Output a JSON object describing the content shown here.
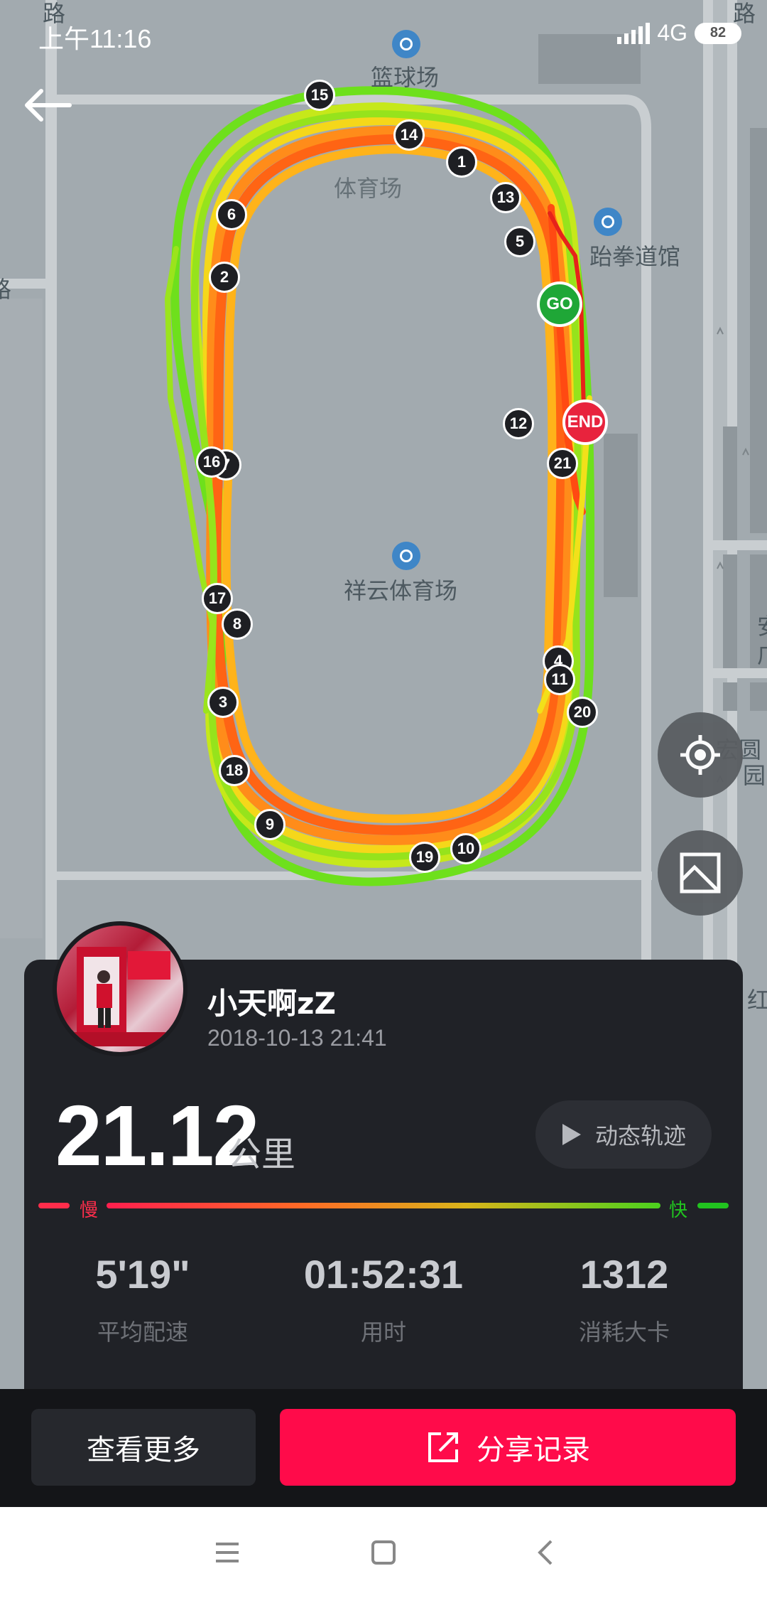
{
  "status_bar": {
    "time": "上午11:16",
    "network": "4G",
    "battery": "82"
  },
  "map": {
    "labels": {
      "road_top_left": "路",
      "road_top_right": "路",
      "basketball": "篮球场",
      "stadium_small": "体育场",
      "taekwondo": "跆拳道馆",
      "stadium": "祥云体育场",
      "right_an": "安",
      "right_guang": "广",
      "hongyuan": "宏圆",
      "yuan": "园",
      "hong": "红",
      "left_edge": "路"
    },
    "km_markers": [
      "1",
      "2",
      "3",
      "4",
      "5",
      "6",
      "7",
      "8",
      "9",
      "10",
      "11",
      "12",
      "13",
      "14",
      "15",
      "16",
      "17",
      "18",
      "19",
      "20",
      "21"
    ],
    "start_label": "GO",
    "end_label": "END"
  },
  "profile": {
    "name": "小天啊zZ",
    "date": "2018-10-13 21:41"
  },
  "distance": {
    "value": "21.12",
    "unit": "公里"
  },
  "replay_label": "动态轨迹",
  "pace_legend": {
    "slow": "慢",
    "fast": "快"
  },
  "stats": [
    {
      "value": "5'19\"",
      "label": "平均配速"
    },
    {
      "value": "01:52:31",
      "label": "用时"
    },
    {
      "value": "1312",
      "label": "消耗大卡"
    }
  ],
  "actions": {
    "more": "查看更多",
    "share": "分享记录"
  },
  "colors": {
    "accent": "#ff0b4a",
    "slow": "#ff2d4b",
    "fast": "#21c31f",
    "card": "#202227"
  }
}
